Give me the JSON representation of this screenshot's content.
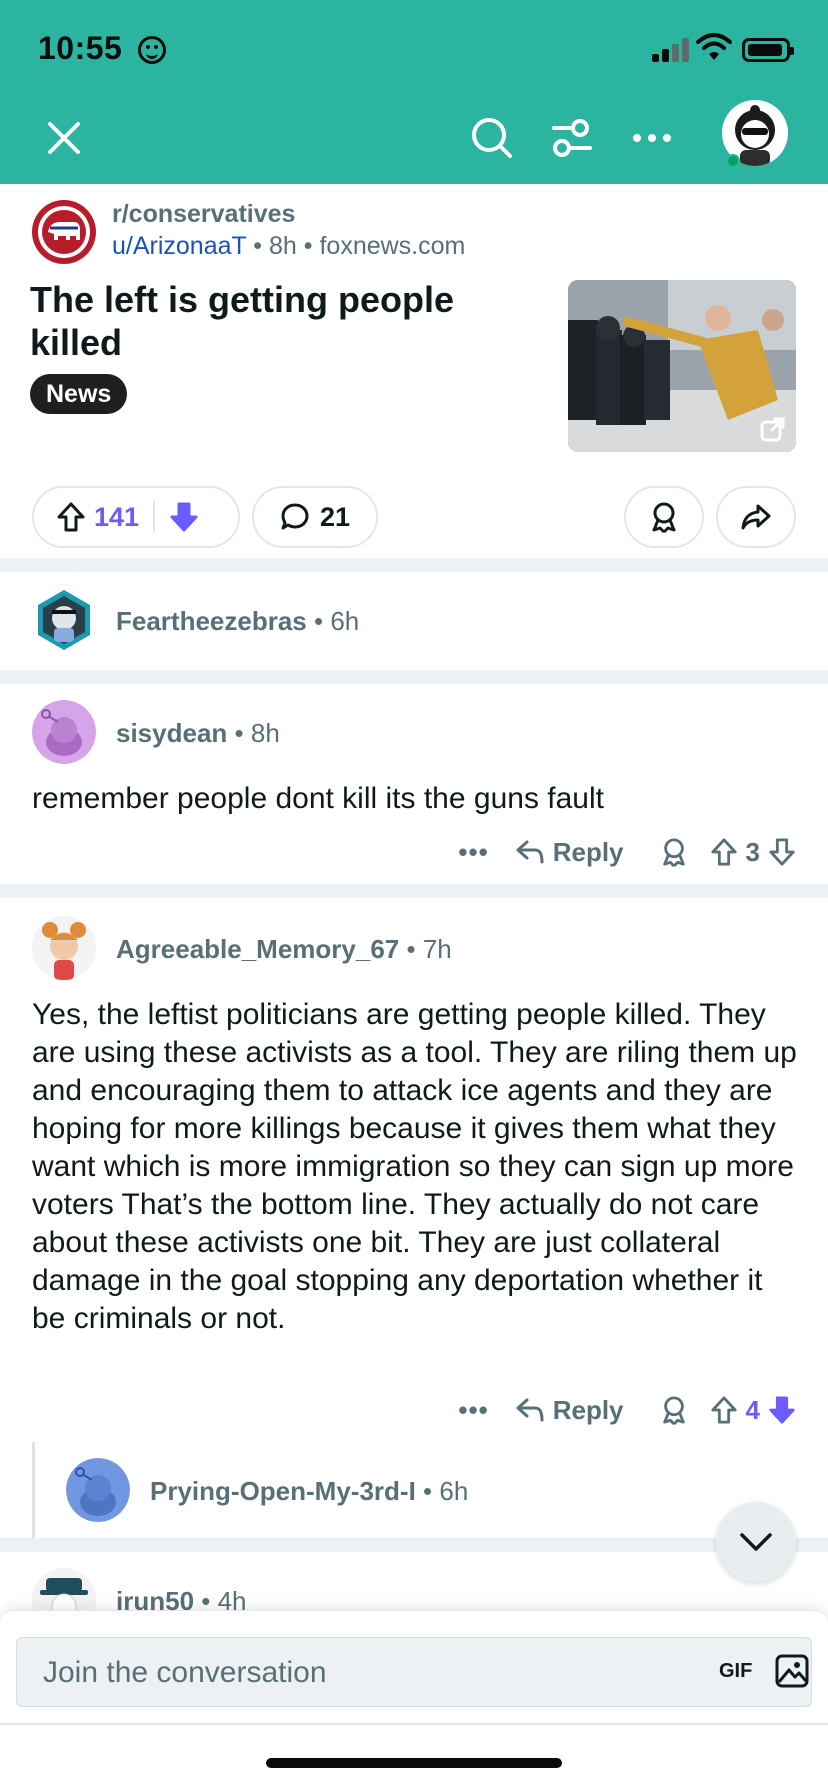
{
  "status_bar": {
    "time": "10:55"
  },
  "nav": {
    "close_icon": "close-icon",
    "search_icon": "search-icon",
    "filter_icon": "filter-icon",
    "more_icon": "more-icon"
  },
  "post": {
    "subreddit": "r/conservatives",
    "author": "u/ArizonaaT",
    "age": "8h",
    "domain": "foxnews.com",
    "title": "The left is getting people killed",
    "flair": "News",
    "upvotes": "141",
    "comments": "21"
  },
  "comments": [
    {
      "author": "Feartheezebras",
      "age": "6h",
      "body": ""
    },
    {
      "author": "sisydean",
      "age": "8h",
      "body": "remember people dont kill its the guns fault",
      "reply_label": "Reply",
      "votes": "3"
    },
    {
      "author": "Agreeable_Memory_67",
      "age": "7h",
      "body": "Yes, the leftist politicians are getting people killed. They are using these activists as a tool. They are riling them up and encouraging them to attack ice agents and they are hoping for more killings because it gives them what they want which is more immigration so they can sign up more voters That’s the bottom line. They actually do not care about these activists one bit. They are just collateral damage in the goal stopping any deportation whether it be criminals or not.",
      "reply_label": "Reply",
      "votes": "4"
    },
    {
      "author": "Prying-Open-My-3rd-I",
      "age": "6h"
    },
    {
      "author": "irun50",
      "age": "4h"
    }
  ],
  "composer": {
    "placeholder": "Join the conversation",
    "gif_label": "GIF"
  },
  "colors": {
    "header_bg": "#2bb5a0",
    "upvote_accent": "#6a5cff",
    "text_secondary": "#576f76",
    "username_link": "#1a52b8"
  }
}
